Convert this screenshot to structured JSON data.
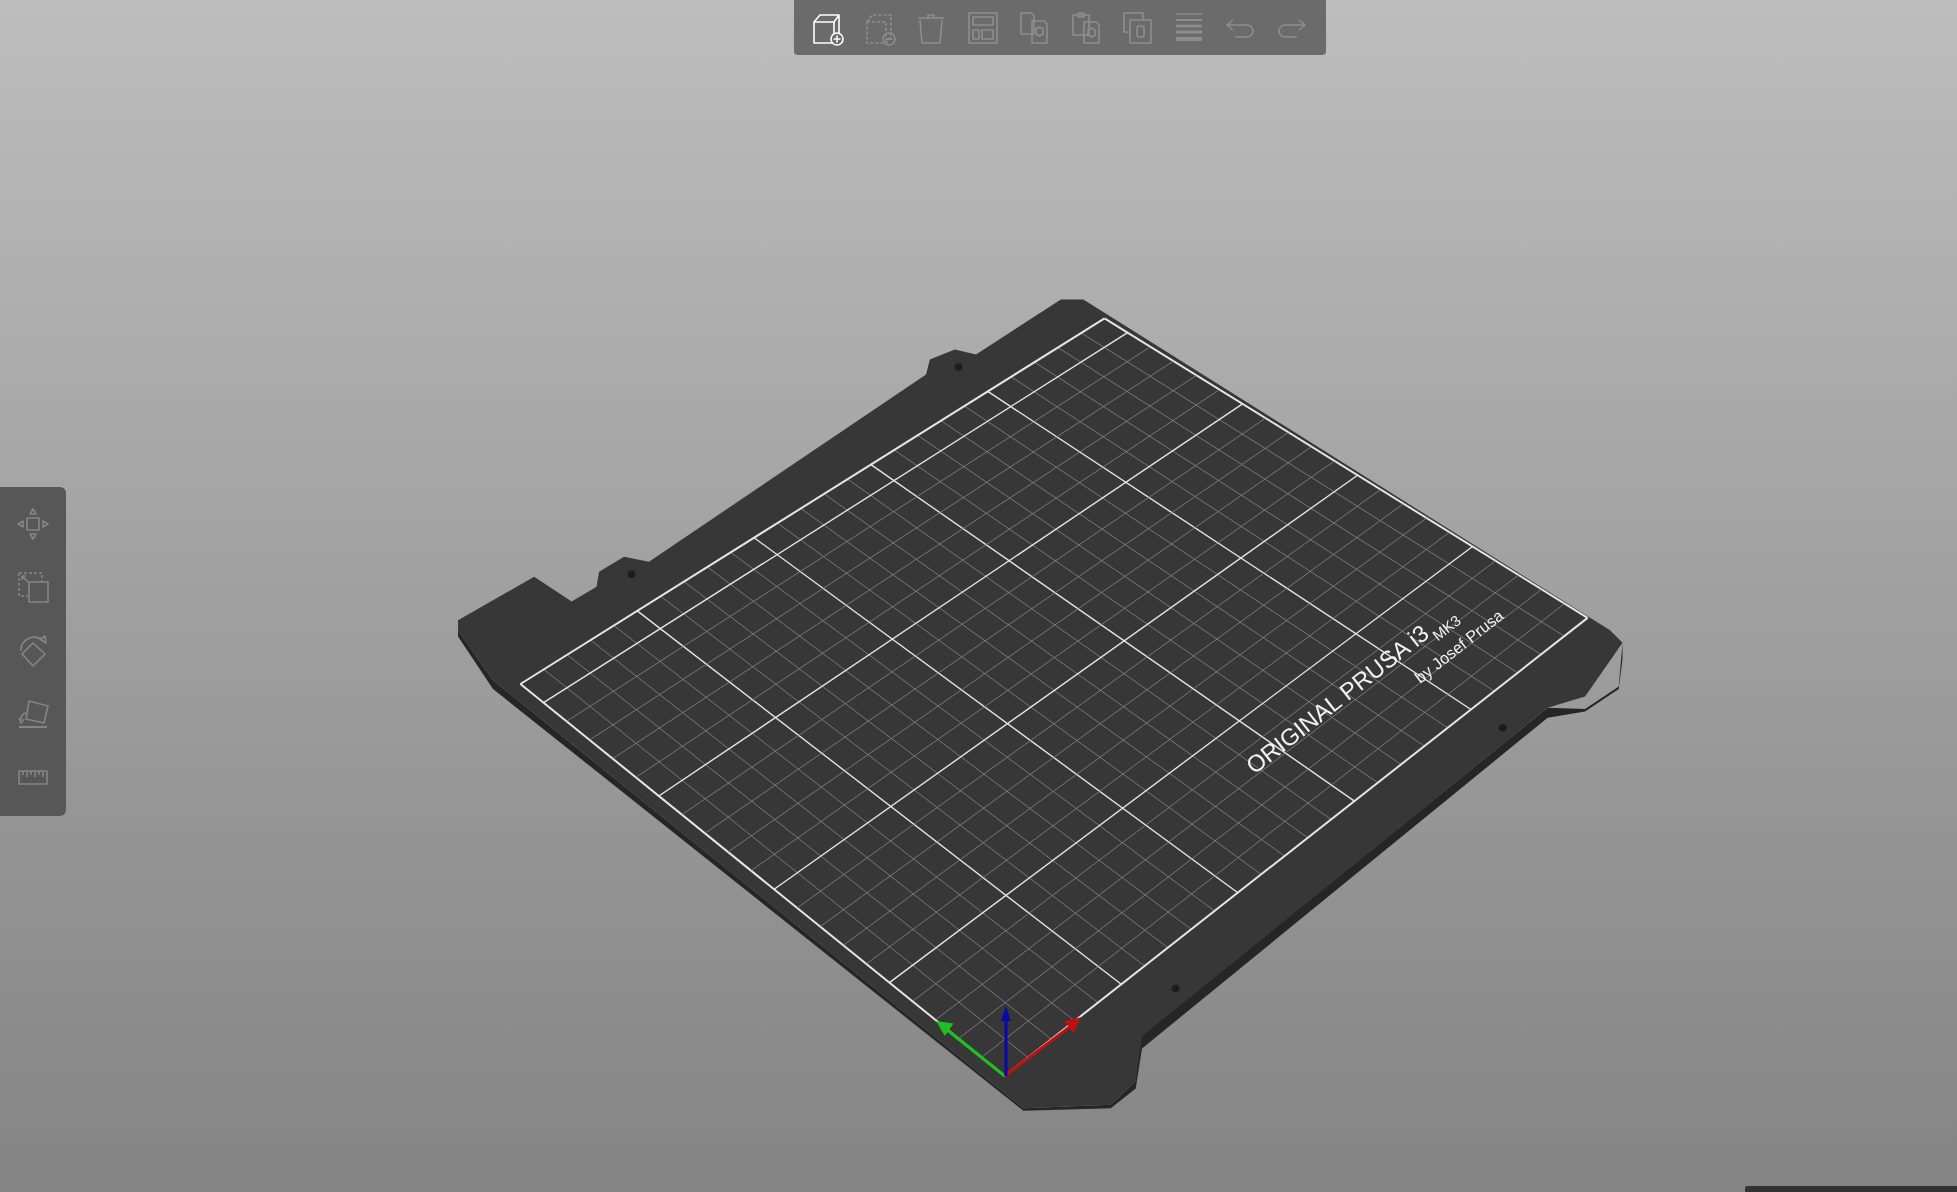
{
  "toolbar": {
    "buttons": [
      {
        "kind": "add",
        "disabled": false
      },
      {
        "kind": "delete",
        "disabled": true
      },
      {
        "kind": "delete_all",
        "disabled": true
      },
      {
        "kind": "arrange",
        "disabled": true
      },
      {
        "kind": "copy",
        "disabled": true
      },
      {
        "kind": "paste",
        "disabled": true
      },
      {
        "kind": "instance",
        "disabled": true
      },
      {
        "kind": "layers",
        "disabled": true
      },
      {
        "kind": "undo",
        "disabled": true
      },
      {
        "kind": "redo",
        "disabled": true
      }
    ]
  },
  "gizmos": [
    {
      "kind": "move"
    },
    {
      "kind": "scale"
    },
    {
      "kind": "rotate"
    },
    {
      "kind": "place_on_face"
    },
    {
      "kind": "measure"
    }
  ],
  "bed": {
    "logo": "ORIGINAL PRUSA i3",
    "model": "MK3",
    "credit": "by Josef Prusa"
  }
}
